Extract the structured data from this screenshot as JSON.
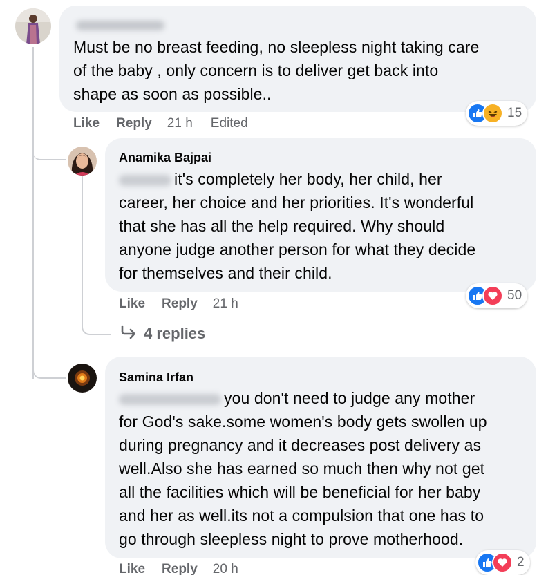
{
  "comments": [
    {
      "author": "",
      "text_lines": [
        "Must be no breast feeding, no sleepless night taking care",
        "of the baby , only concern is to deliver get back into",
        "shape as soon as possible.."
      ],
      "actions": {
        "like": "Like",
        "reply": "Reply",
        "time": "21 h",
        "edited": "Edited"
      },
      "reactions": {
        "icons": [
          "like-icon",
          "haha-icon"
        ],
        "count": "15"
      }
    },
    {
      "author": "Anamika Bajpai",
      "text_lines": [
        "it's completely her body, her child, her",
        "career, her choice and her priorities. It's wonderful",
        "that she has all the help required. Why should",
        "anyone judge another person for what they decide",
        "for themselves and their child."
      ],
      "actions": {
        "like": "Like",
        "reply": "Reply",
        "time": "21 h"
      },
      "reactions": {
        "icons": [
          "like-icon",
          "love-icon"
        ],
        "count": "50"
      },
      "more_replies": "4 replies"
    },
    {
      "author": "Samina Irfan",
      "text_lines": [
        "you don't need to judge any mother",
        "for God's sake.some women's body gets swollen up",
        "during pregnancy and it decreases post delivery as",
        "well.Also she has earned so much then why not get",
        "all the facilities which will be beneficial for her baby",
        "and her as well.its not a compulsion that one has to",
        "go through sleepless night to prove motherhood."
      ],
      "actions": {
        "like": "Like",
        "reply": "Reply",
        "time": "20 h"
      },
      "reactions": {
        "icons": [
          "like-icon",
          "love-icon"
        ],
        "count": "2"
      }
    }
  ],
  "colors": {
    "bubble": "#f0f2f5",
    "meta_text": "#65676b",
    "like_blue": "#1877f2",
    "love_red": "#f33e58",
    "haha_yellow": "#f7b125",
    "thread_line": "#ced0d4"
  }
}
